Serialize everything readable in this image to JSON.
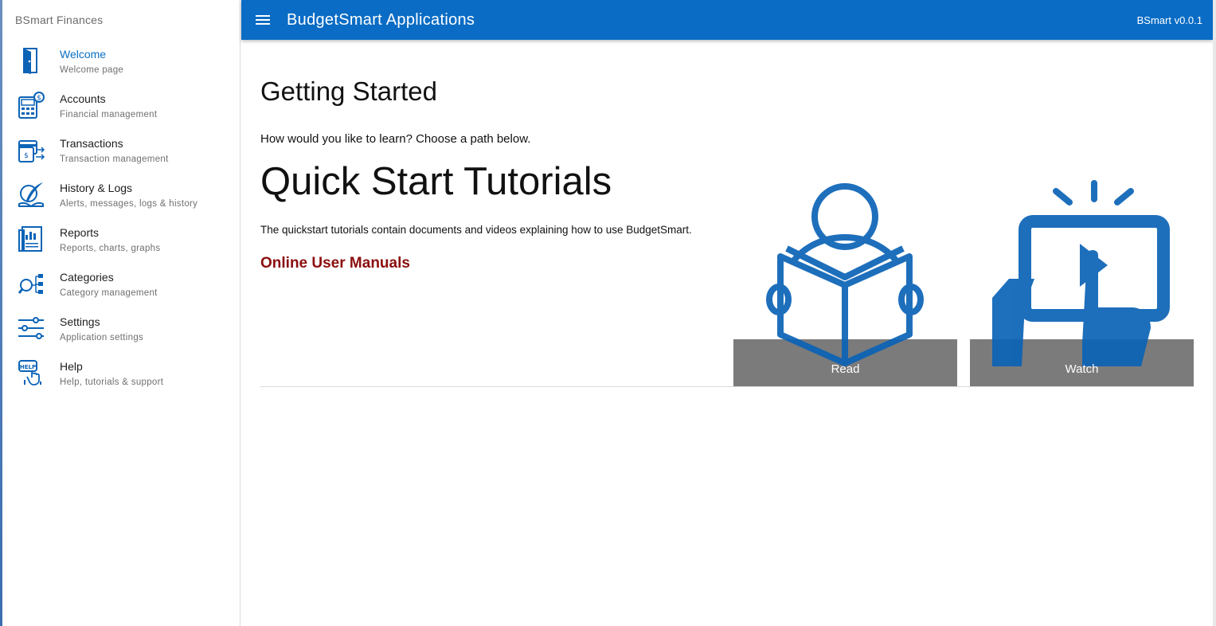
{
  "sidebar": {
    "title": "BSmart Finances",
    "items": [
      {
        "label": "Welcome",
        "sub": "Welcome page",
        "icon": "door-icon",
        "active": true
      },
      {
        "label": "Accounts",
        "sub": "Financial management",
        "icon": "calculator-dollar-icon"
      },
      {
        "label": "Transactions",
        "sub": "Transaction management",
        "icon": "card-transfer-icon"
      },
      {
        "label": "History & Logs",
        "sub": "Alerts, messages, logs & history",
        "icon": "quill-book-icon"
      },
      {
        "label": "Reports",
        "sub": "Reports, charts, graphs",
        "icon": "report-chart-icon"
      },
      {
        "label": "Categories",
        "sub": "Category management",
        "icon": "magnifier-network-icon"
      },
      {
        "label": "Settings",
        "sub": "Application settings",
        "icon": "sliders-icon"
      },
      {
        "label": "Help",
        "sub": "Help, tutorials & support",
        "icon": "help-sign-icon"
      }
    ]
  },
  "header": {
    "title": "BudgetSmart Applications",
    "version": "BSmart v0.0.1",
    "menu_icon": "hamburger-menu-icon",
    "color": "#0a6cc4"
  },
  "main": {
    "heading": "Getting Started",
    "intro": "How would you like to learn? Choose a path below.",
    "section_title": "Quick Start Tutorials",
    "section_desc": "The quickstart tutorials contain documents and videos explaining how to use BudgetSmart.",
    "manuals_link": "Online User Manuals",
    "cards": [
      {
        "label": "Read",
        "icon": "reading-person-icon"
      },
      {
        "label": "Watch",
        "icon": "tablet-video-play-icon"
      }
    ]
  },
  "colors": {
    "accent": "#0a6cc4",
    "icon_blue": "#0b63b6",
    "link_red": "#8b0f0f",
    "card_overlay": "#646464"
  }
}
